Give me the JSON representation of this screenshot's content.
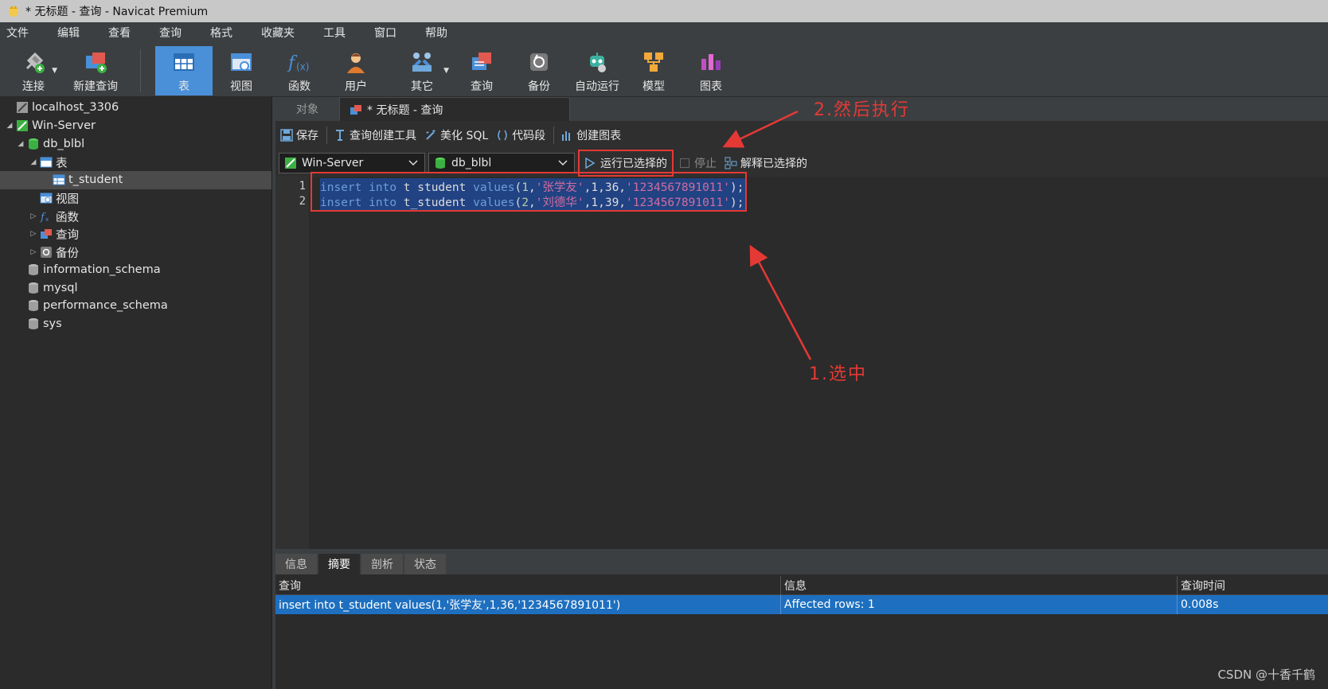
{
  "window": {
    "title": "* 无标题 - 查询 - Navicat Premium"
  },
  "menu": [
    "文件",
    "编辑",
    "查看",
    "查询",
    "格式",
    "收藏夹",
    "工具",
    "窗口",
    "帮助"
  ],
  "toolbar": {
    "connect": "连接",
    "new_query": "新建查询",
    "table": "表",
    "view": "视图",
    "function": "函数",
    "user": "用户",
    "other": "其它",
    "query": "查询",
    "backup": "备份",
    "automation": "自动运行",
    "model": "模型",
    "chart": "图表"
  },
  "tree": {
    "localhost": "localhost_3306",
    "win_server": "Win-Server",
    "db_blbl": "db_blbl",
    "tables": "表",
    "t_student": "t_student",
    "views": "视图",
    "functions": "函数",
    "queries": "查询",
    "backups": "备份",
    "information_schema": "information_schema",
    "mysql": "mysql",
    "performance_schema": "performance_schema",
    "sys": "sys"
  },
  "tabs": {
    "objects": "对象",
    "query_tab": "* 无标题 - 查询"
  },
  "query_toolbar": {
    "save": "保存",
    "query_builder": "查询创建工具",
    "beautify": "美化 SQL",
    "snippet": "代码段",
    "create_chart": "创建图表"
  },
  "selectors": {
    "connection": "Win-Server",
    "database": "db_blbl",
    "run_selected": "运行已选择的",
    "stop": "停止",
    "explain_selected": "解释已选择的"
  },
  "editor": {
    "line_numbers": [
      "1",
      "2"
    ],
    "line1": {
      "kw1": "insert",
      "kw2": "into",
      "table": "t_student",
      "kw3": "values",
      "open": "(",
      "n1": "1",
      "c1": ",",
      "s1": "'张学友'",
      "rest1": ",1,36,",
      "s2": "'1234567891011'",
      "close": ");"
    },
    "line2": {
      "kw1": "insert",
      "kw2": "into",
      "table": "t_student",
      "kw3": "values",
      "open": "(",
      "n1": "2",
      "c1": ",",
      "s1": "'刘德华'",
      "rest1": ",1,39,",
      "s2": "'1234567891011'",
      "close": ");"
    }
  },
  "result_tabs": [
    "信息",
    "摘要",
    "剖析",
    "状态"
  ],
  "results": {
    "headers": [
      "查询",
      "信息",
      "查询时间"
    ],
    "row": [
      "insert into t_student values(1,'张学友',1,36,'1234567891011')",
      "Affected rows: 1",
      "0.008s"
    ]
  },
  "annotations": {
    "step2": "2.然后执行",
    "step1": "1.选中"
  },
  "watermark": "CSDN @十香千鹤",
  "colors": {
    "accent": "#4a90d9",
    "annotation": "#e53935",
    "selection": "#214283",
    "result_row": "#1e6fbf"
  }
}
